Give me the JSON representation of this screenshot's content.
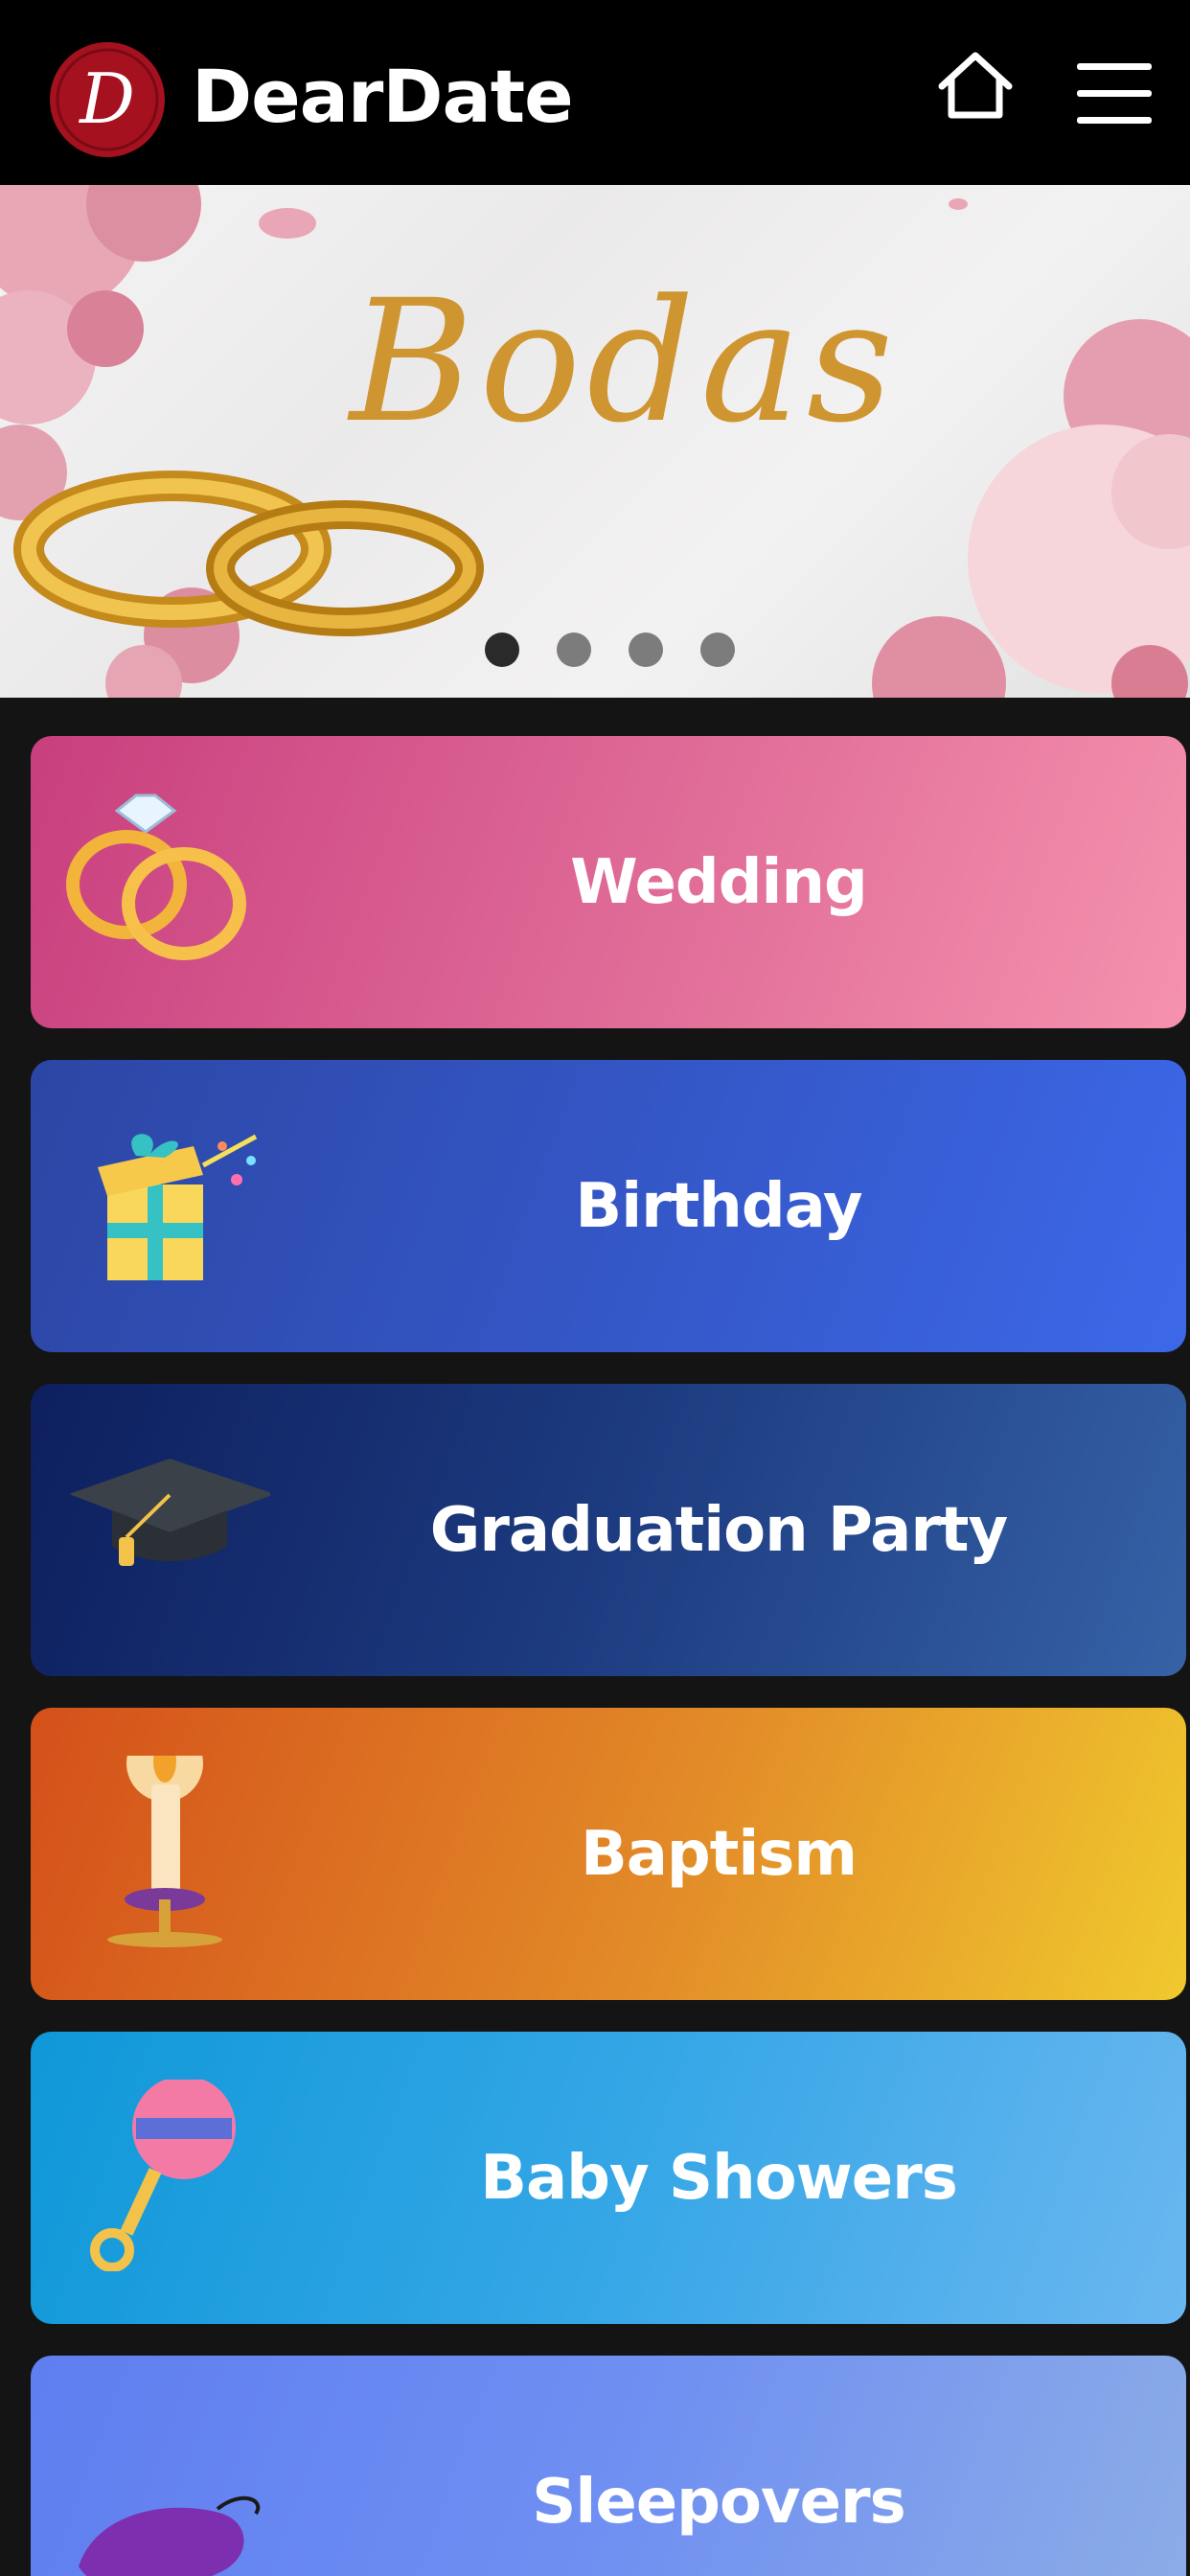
{
  "app": {
    "brand": "DearDate",
    "logo_letter": "D"
  },
  "header": {
    "home_icon": "home-icon",
    "menu_icon": "hamburger-menu-icon"
  },
  "banner": {
    "title": "Bodas",
    "slide_count": 4,
    "active_slide": 1
  },
  "categories": [
    {
      "label": "Wedding",
      "icon": "wedding-rings-icon",
      "color": "#d95a8e"
    },
    {
      "label": "Birthday",
      "icon": "gift-box-icon",
      "color": "#3456c5"
    },
    {
      "label": "Graduation Party",
      "icon": "graduation-cap-icon",
      "color": "#1d3b80"
    },
    {
      "label": "Baptism",
      "icon": "candle-icon",
      "color": "#e28a28"
    },
    {
      "label": "Baby Showers",
      "icon": "baby-rattle-icon",
      "color": "#34a6e6"
    },
    {
      "label": "Sleepovers",
      "icon": "sleep-mask-icon",
      "color": "#6f8ff2"
    }
  ]
}
